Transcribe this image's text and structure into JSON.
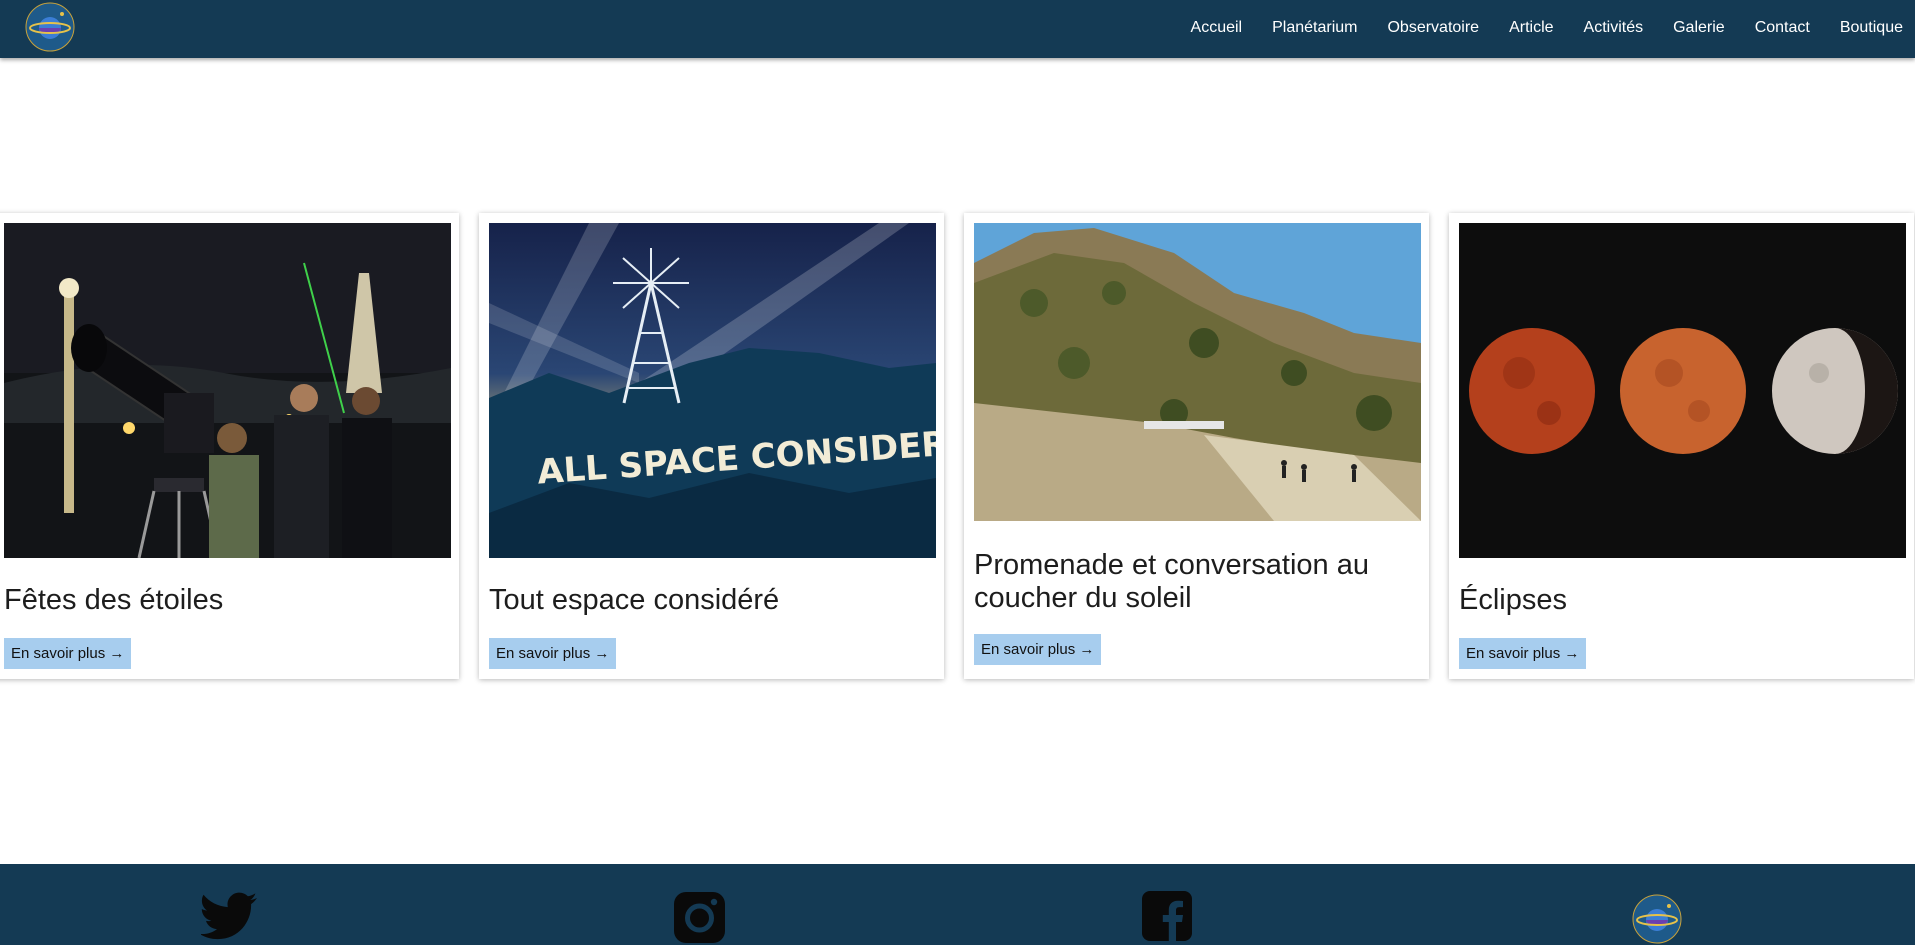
{
  "header": {
    "logo_icon": "planet-logo-icon",
    "nav": [
      "Accueil",
      "Planétarium",
      "Observatoire",
      "Article",
      "Activités",
      "Galerie",
      "Contact",
      "Boutique"
    ]
  },
  "cards": [
    {
      "title": "Fêtes des étoiles",
      "button": "En savoir plus →",
      "image": "telescope-night-photo"
    },
    {
      "title": "Tout espace considéré",
      "button": "En savoir plus →",
      "image": "all-space-considered-poster",
      "image_text": "ALL SPACE CONSIDERED"
    },
    {
      "title": "Promenade et conversation au coucher du soleil",
      "button": "En savoir plus →",
      "image": "hillside-trail-photo"
    },
    {
      "title": "Éclipses",
      "button": "En savoir plus →",
      "image": "lunar-eclipse-phases-photo"
    }
  ],
  "footer": {
    "icons": [
      "twitter-icon",
      "instagram-icon",
      "facebook-icon",
      "planet-logo-icon"
    ]
  },
  "colors": {
    "header_bg": "#143a54",
    "footer_bg": "#143a54",
    "button_bg": "#a7cdee"
  }
}
